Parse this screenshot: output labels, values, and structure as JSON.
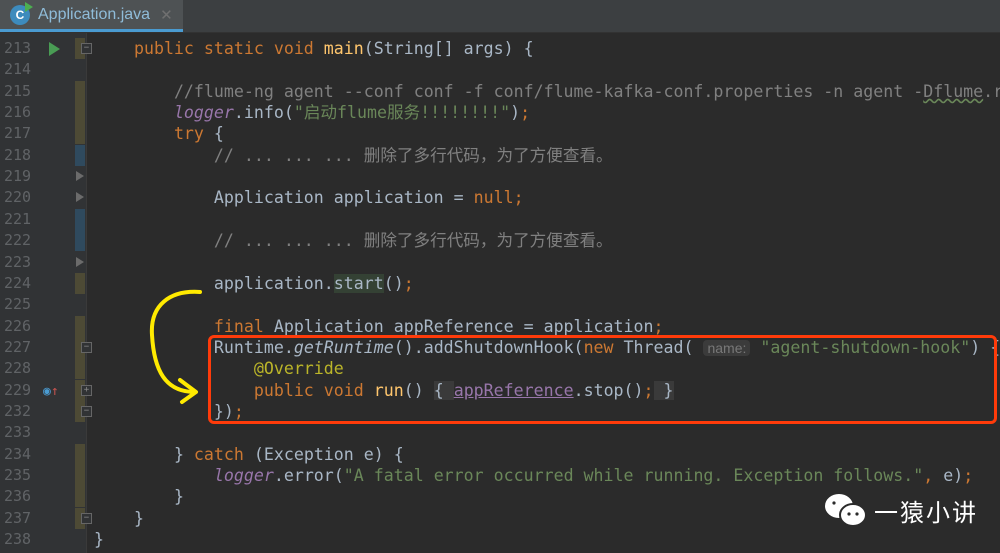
{
  "tab": {
    "label": "Application.java",
    "icon": "C",
    "close": "✕"
  },
  "watermark": {
    "label": "一猿小讲"
  },
  "lines": [
    {
      "n": "213",
      "marks": "olive",
      "run": true,
      "fold": "−",
      "tokens": [
        [
          "    ",
          "pl"
        ],
        [
          "public static void ",
          "kw"
        ],
        [
          "main",
          "fn"
        ],
        [
          "(String[] args) {",
          "pl"
        ]
      ]
    },
    {
      "n": "214",
      "tokens": []
    },
    {
      "n": "215",
      "marks": "olive",
      "tokens": [
        [
          "        ",
          "pl"
        ],
        [
          "//flume-ng agent --conf conf -f conf/flume-kafka-conf.properties -n agent -",
          "cm"
        ],
        [
          "Dflume",
          "cm warn"
        ],
        [
          ".r",
          "cm"
        ]
      ]
    },
    {
      "n": "216",
      "marks": "olive",
      "tokens": [
        [
          "        ",
          "pl"
        ],
        [
          "logger",
          "fld"
        ],
        [
          ".info(",
          "pl"
        ],
        [
          "\"启动flume服务!!!!!!!!\"",
          "str"
        ],
        [
          ")",
          "pl"
        ],
        [
          ";",
          "kw"
        ]
      ]
    },
    {
      "n": "217",
      "marks": "olive",
      "tokens": [
        [
          "        ",
          "pl"
        ],
        [
          "try ",
          "kw"
        ],
        [
          "{",
          "pl"
        ]
      ]
    },
    {
      "n": "218",
      "marks": "blue",
      "tokens": [
        [
          "            ",
          "pl"
        ],
        [
          "// ... ... ... 删除了多行代码，为了方便查看。",
          "cm"
        ]
      ]
    },
    {
      "n": "219",
      "tri": true,
      "tokens": []
    },
    {
      "n": "220",
      "tri": true,
      "tokens": [
        [
          "            ",
          "pl"
        ],
        [
          "Application application = ",
          "pl"
        ],
        [
          "null",
          "kw"
        ],
        [
          ";",
          "kw"
        ]
      ]
    },
    {
      "n": "221",
      "marks": "blue",
      "tokens": []
    },
    {
      "n": "222",
      "marks": "blue",
      "tokens": [
        [
          "            ",
          "pl"
        ],
        [
          "// ... ... ... 删除了多行代码，为了方便查看。",
          "cm"
        ]
      ]
    },
    {
      "n": "223",
      "tri": true,
      "tokens": []
    },
    {
      "n": "224",
      "marks": "olive",
      "tokens": [
        [
          "            ",
          "pl"
        ],
        [
          "application.",
          "pl"
        ],
        [
          "start",
          "pl hl"
        ],
        [
          "()",
          "pl"
        ],
        [
          ";",
          "kw"
        ]
      ]
    },
    {
      "n": "225",
      "tokens": []
    },
    {
      "n": "226",
      "marks": "olive",
      "tokens": [
        [
          "            ",
          "pl"
        ],
        [
          "final ",
          "kw"
        ],
        [
          "Application appReference = application",
          "pl"
        ],
        [
          ";",
          "kw"
        ]
      ]
    },
    {
      "n": "227",
      "marks": "olive",
      "fold": "−",
      "tokens": [
        [
          "            ",
          "pl"
        ],
        [
          "Runtime.",
          "pl"
        ],
        [
          "getRuntime",
          "it"
        ],
        [
          "().addShutdownHook(",
          "pl"
        ],
        [
          "new ",
          "kw"
        ],
        [
          "Thread( ",
          "pl"
        ],
        [
          "name:",
          "hint"
        ],
        [
          " ",
          "pl"
        ],
        [
          "\"agent-shutdown-hook\"",
          "str"
        ],
        [
          ") {",
          "pl"
        ]
      ]
    },
    {
      "n": "228",
      "marks": "olive",
      "tokens": [
        [
          "                ",
          "pl"
        ],
        [
          "@Override",
          "ann"
        ]
      ]
    },
    {
      "n": "229",
      "marks": "olive",
      "override": true,
      "fold": "+",
      "tokens": [
        [
          "                ",
          "pl"
        ],
        [
          "public void ",
          "kw"
        ],
        [
          "run",
          "fn"
        ],
        [
          "() ",
          "pl"
        ],
        [
          "{ ",
          "fold"
        ],
        [
          "appReference",
          "link"
        ],
        [
          ".stop()",
          "pl"
        ],
        [
          ";",
          "kw"
        ],
        [
          " }",
          "fold"
        ]
      ]
    },
    {
      "n": "232",
      "marks": "olive",
      "fold": "−",
      "tokens": [
        [
          "            ",
          "pl"
        ],
        [
          "})",
          "pl"
        ],
        [
          ";",
          "kw"
        ]
      ]
    },
    {
      "n": "233",
      "tokens": []
    },
    {
      "n": "234",
      "marks": "olive",
      "tokens": [
        [
          "        ",
          "pl"
        ],
        [
          "} ",
          "pl"
        ],
        [
          "catch ",
          "kw"
        ],
        [
          "(Exception e) {",
          "pl"
        ]
      ]
    },
    {
      "n": "235",
      "marks": "olive",
      "tokens": [
        [
          "            ",
          "pl"
        ],
        [
          "logger",
          "fld"
        ],
        [
          ".error(",
          "pl"
        ],
        [
          "\"A fatal error occurred while running. Exception follows.\"",
          "str"
        ],
        [
          ", ",
          "kw"
        ],
        [
          "e)",
          "pl"
        ],
        [
          ";",
          "kw"
        ]
      ]
    },
    {
      "n": "236",
      "marks": "olive",
      "tokens": [
        [
          "        ",
          "pl"
        ],
        [
          "}",
          "pl"
        ]
      ]
    },
    {
      "n": "237",
      "marks": "olive",
      "fold": "−",
      "tokens": [
        [
          "    ",
          "pl"
        ],
        [
          "}",
          "pl"
        ]
      ]
    },
    {
      "n": "238",
      "tokens": [
        [
          "}",
          "pl"
        ]
      ]
    }
  ],
  "colors": {
    "highlight_box": "#ff3b0a",
    "arrow": "#ffea00",
    "background": "#2b2b2b"
  }
}
